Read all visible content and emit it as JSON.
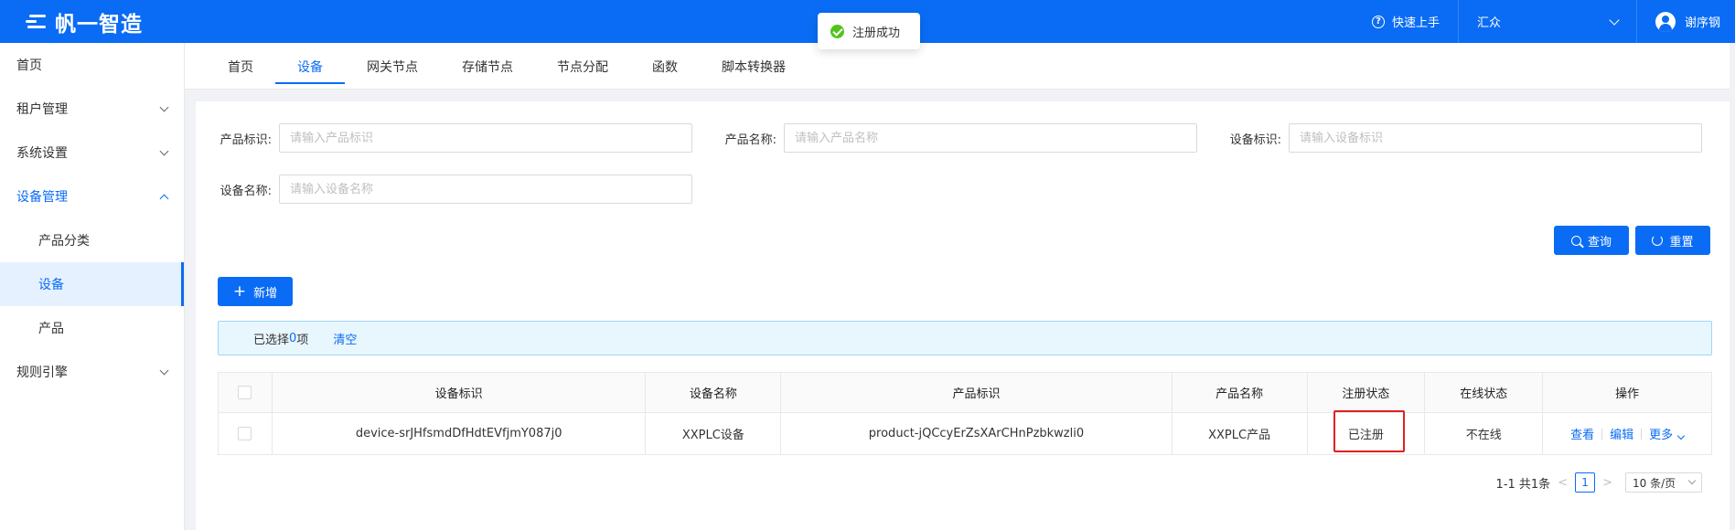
{
  "header": {
    "brand": "帆一智造",
    "quick_start": "快速上手",
    "tenant": "汇众",
    "user": "谢序钢"
  },
  "toast": {
    "message": "注册成功"
  },
  "sidebar": {
    "items": [
      {
        "label": "首页"
      },
      {
        "label": "租户管理"
      },
      {
        "label": "系统设置"
      },
      {
        "label": "设备管理"
      },
      {
        "label": "产品分类"
      },
      {
        "label": "设备"
      },
      {
        "label": "产品"
      },
      {
        "label": "规则引擎"
      }
    ]
  },
  "tabs": [
    "首页",
    "设备",
    "网关节点",
    "存储节点",
    "节点分配",
    "函数",
    "脚本转换器"
  ],
  "filters": {
    "product_id": {
      "label": "产品标识:",
      "placeholder": "请输入产品标识"
    },
    "product_name": {
      "label": "产品名称:",
      "placeholder": "请输入产品名称"
    },
    "device_id": {
      "label": "设备标识:",
      "placeholder": "请输入设备标识"
    },
    "device_name": {
      "label": "设备名称:",
      "placeholder": "请输入设备名称"
    }
  },
  "buttons": {
    "query": "查询",
    "reset": "重置",
    "add": "新增"
  },
  "selection": {
    "prefix": "已选择 ",
    "count": "0",
    "suffix": "项",
    "clear": "清空"
  },
  "table": {
    "headers": [
      "设备标识",
      "设备名称",
      "产品标识",
      "产品名称",
      "注册状态",
      "在线状态",
      "操作"
    ],
    "rows": [
      {
        "device_id": "device-srJHfsmdDfHdtEVfjmY087j0",
        "device_name": "XXPLC设备",
        "product_id": "product-jQCcyErZsXArCHnPzbkwzli0",
        "product_name": "XXPLC产品",
        "register_status": "已注册",
        "online_status": "不在线",
        "actions": {
          "view": "查看",
          "edit": "编辑",
          "more": "更多"
        }
      }
    ]
  },
  "pagination": {
    "summary": "1-1 共1条",
    "current_page": "1",
    "page_size": "10 条/页"
  }
}
